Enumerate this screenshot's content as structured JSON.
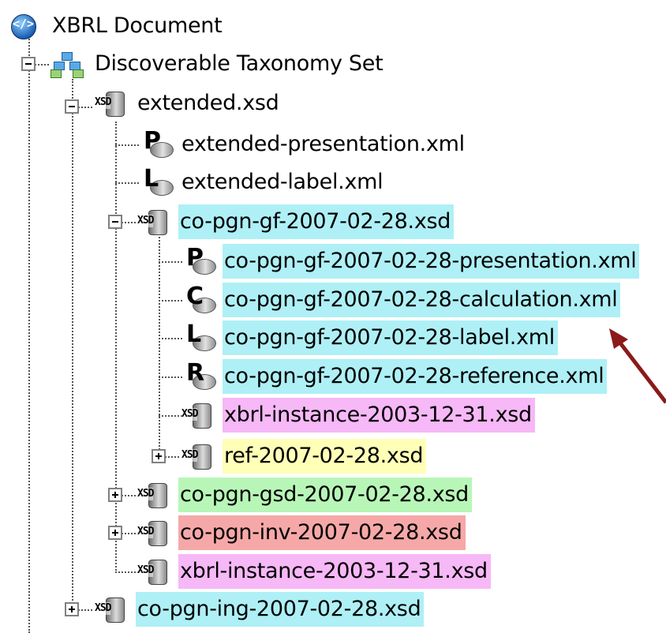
{
  "tree": {
    "root": {
      "label": "XBRL Document",
      "icon": "xbrl-document-icon"
    },
    "dts": {
      "label": "Discoverable Taxonomy Set",
      "icon": "taxonomy-set-icon",
      "state": "expanded"
    },
    "extended_xsd": {
      "label": "extended.xsd",
      "icon": "xsd-schema-icon",
      "state": "expanded"
    },
    "extended_presentation": {
      "label": "extended-presentation.xml",
      "icon": "presentation-linkbase-icon",
      "letter": "P"
    },
    "extended_label": {
      "label": "extended-label.xml",
      "icon": "label-linkbase-icon",
      "letter": "L"
    },
    "co_pgn_gf": {
      "label": "co-pgn-gf-2007-02-28.xsd",
      "icon": "xsd-schema-icon",
      "state": "expanded",
      "highlight": "#aef0f6"
    },
    "co_pgn_gf_presentation": {
      "label": "co-pgn-gf-2007-02-28-presentation.xml",
      "icon": "presentation-linkbase-icon",
      "letter": "P",
      "highlight": "#aef0f6"
    },
    "co_pgn_gf_calculation": {
      "label": "co-pgn-gf-2007-02-28-calculation.xml",
      "icon": "calculation-linkbase-icon",
      "letter": "C",
      "highlight": "#aef0f6"
    },
    "co_pgn_gf_label": {
      "label": "co-pgn-gf-2007-02-28-label.xml",
      "icon": "label-linkbase-icon",
      "letter": "L",
      "highlight": "#aef0f6"
    },
    "co_pgn_gf_reference": {
      "label": "co-pgn-gf-2007-02-28-reference.xml",
      "icon": "reference-linkbase-icon",
      "letter": "R",
      "highlight": "#aef0f6"
    },
    "xbrl_instance_nested": {
      "label": "xbrl-instance-2003-12-31.xsd",
      "icon": "xsd-schema-icon",
      "highlight": "#f6b8f6"
    },
    "ref_xsd": {
      "label": "ref-2007-02-28.xsd",
      "icon": "xsd-schema-icon",
      "state": "collapsed",
      "highlight": "#ffffb8"
    },
    "co_pgn_gsd": {
      "label": "co-pgn-gsd-2007-02-28.xsd",
      "icon": "xsd-schema-icon",
      "state": "collapsed",
      "highlight": "#b8f6b8"
    },
    "co_pgn_inv": {
      "label": "co-pgn-inv-2007-02-28.xsd",
      "icon": "xsd-schema-icon",
      "state": "collapsed",
      "highlight": "#f6a8a8"
    },
    "xbrl_instance": {
      "label": "xbrl-instance-2003-12-31.xsd",
      "icon": "xsd-schema-icon",
      "highlight": "#f6b8f6"
    },
    "co_pgn_ing": {
      "label": "co-pgn-ing-2007-02-28.xsd",
      "icon": "xsd-schema-icon",
      "state": "collapsed",
      "highlight": "#aef0f6"
    }
  },
  "xsd_icon_text": "XSD",
  "annotation": {
    "type": "arrow",
    "color": "#8b1a1a",
    "points_to": "co_pgn_gf_label"
  }
}
